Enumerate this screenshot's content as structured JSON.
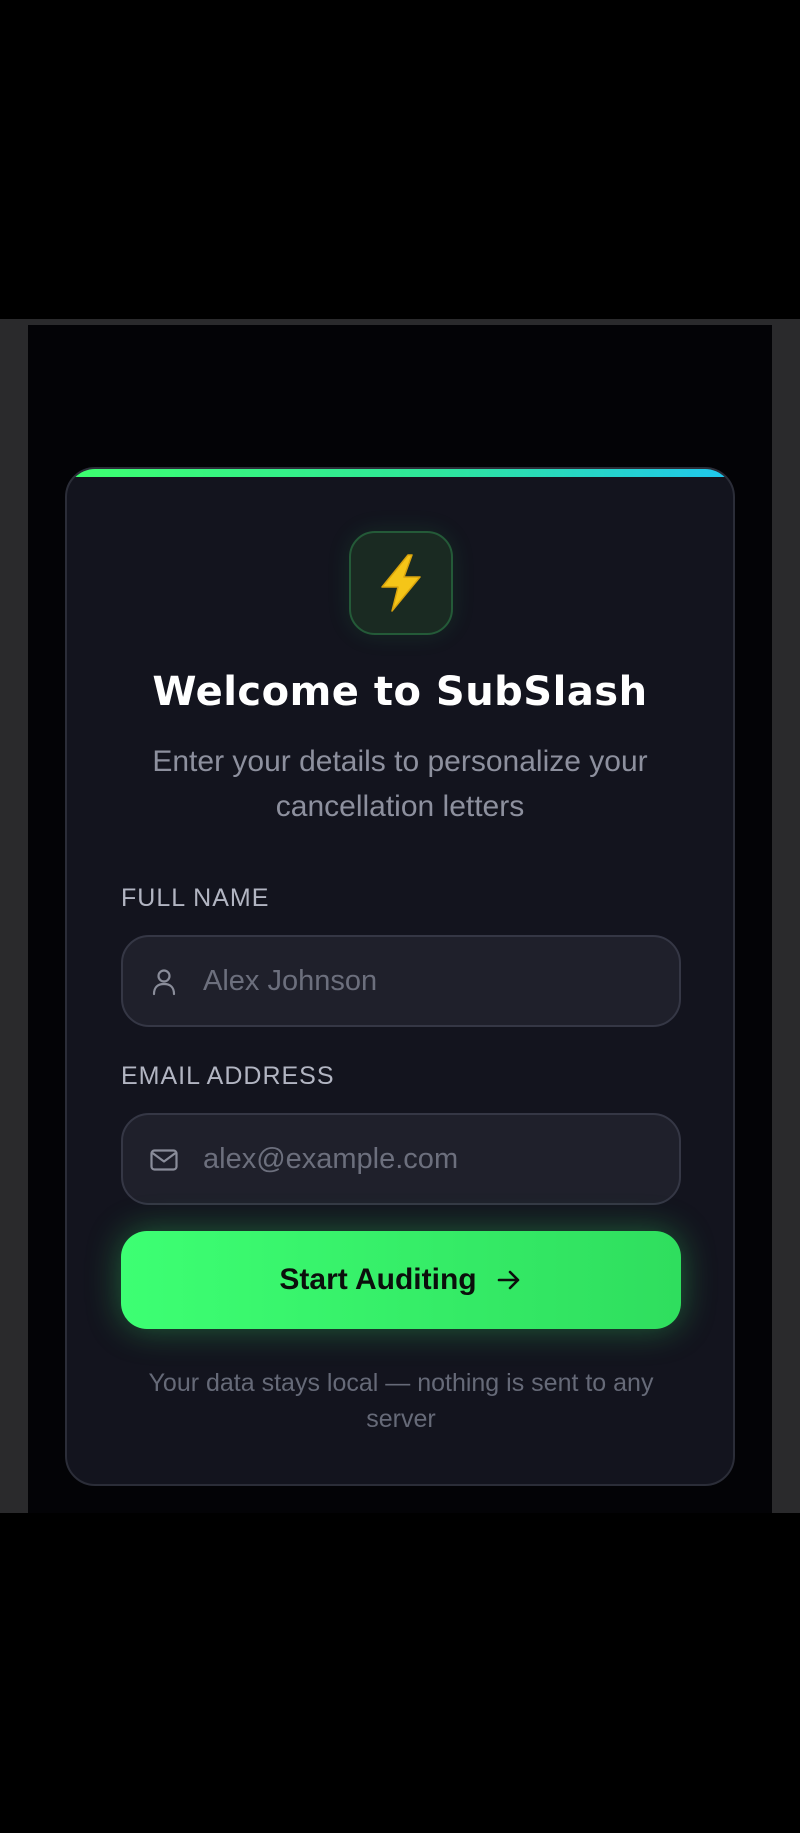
{
  "onboarding": {
    "logo_icon": "lightning-bolt-icon",
    "logo_glyph": "⚡",
    "title": "Welcome to SubSlash",
    "subtitle": "Enter your details to personalize your cancellation letters",
    "full_name": {
      "label": "FULL NAME",
      "placeholder": "Alex Johnson",
      "value": "",
      "icon": "user-icon"
    },
    "email": {
      "label": "EMAIL ADDRESS",
      "placeholder": "alex@example.com",
      "value": "",
      "icon": "mail-icon"
    },
    "cta": {
      "label": "Start Auditing",
      "icon": "arrow-right-icon"
    },
    "footnote": "Your data stays local — nothing is sent to any server"
  },
  "colors": {
    "accent_green": "#3dff73",
    "accent_cyan": "#1fc6ef",
    "card_background": "#13141e",
    "input_background": "#1f202b"
  }
}
